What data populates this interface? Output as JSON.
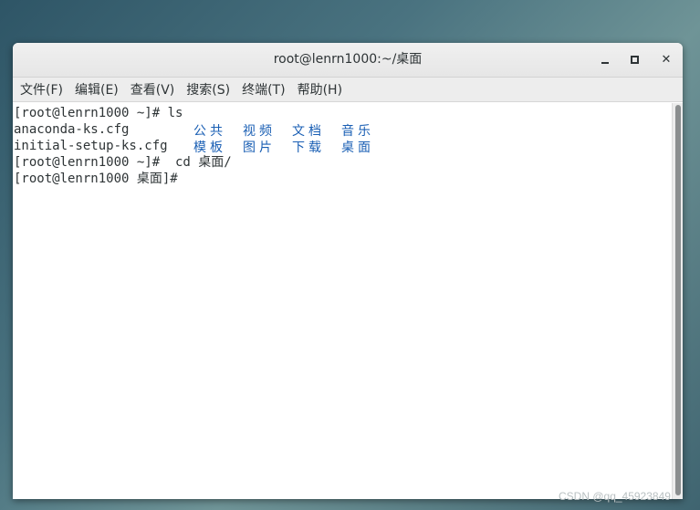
{
  "window": {
    "title": "root@lenrn1000:~/桌面"
  },
  "menu": [
    "文件(F)",
    "编辑(E)",
    "查看(V)",
    "搜索(S)",
    "终端(T)",
    "帮助(H)"
  ],
  "terminal": {
    "lines": [
      "[root@lenrn1000 ~]# ls",
      "anaconda-ks.cfg",
      "initial-setup-ks.cfg",
      "[root@lenrn1000 ~]#  cd 桌面/",
      "[root@lenrn1000 桌面]#"
    ],
    "ls_dirs_row1": [
      "公共",
      "视频",
      "文档",
      "音乐"
    ],
    "ls_dirs_row2": [
      "模板",
      "图片",
      "下载",
      "桌面"
    ],
    "dir_color": "#1a5fb4"
  },
  "watermark": "CSDN @qq_45923849"
}
